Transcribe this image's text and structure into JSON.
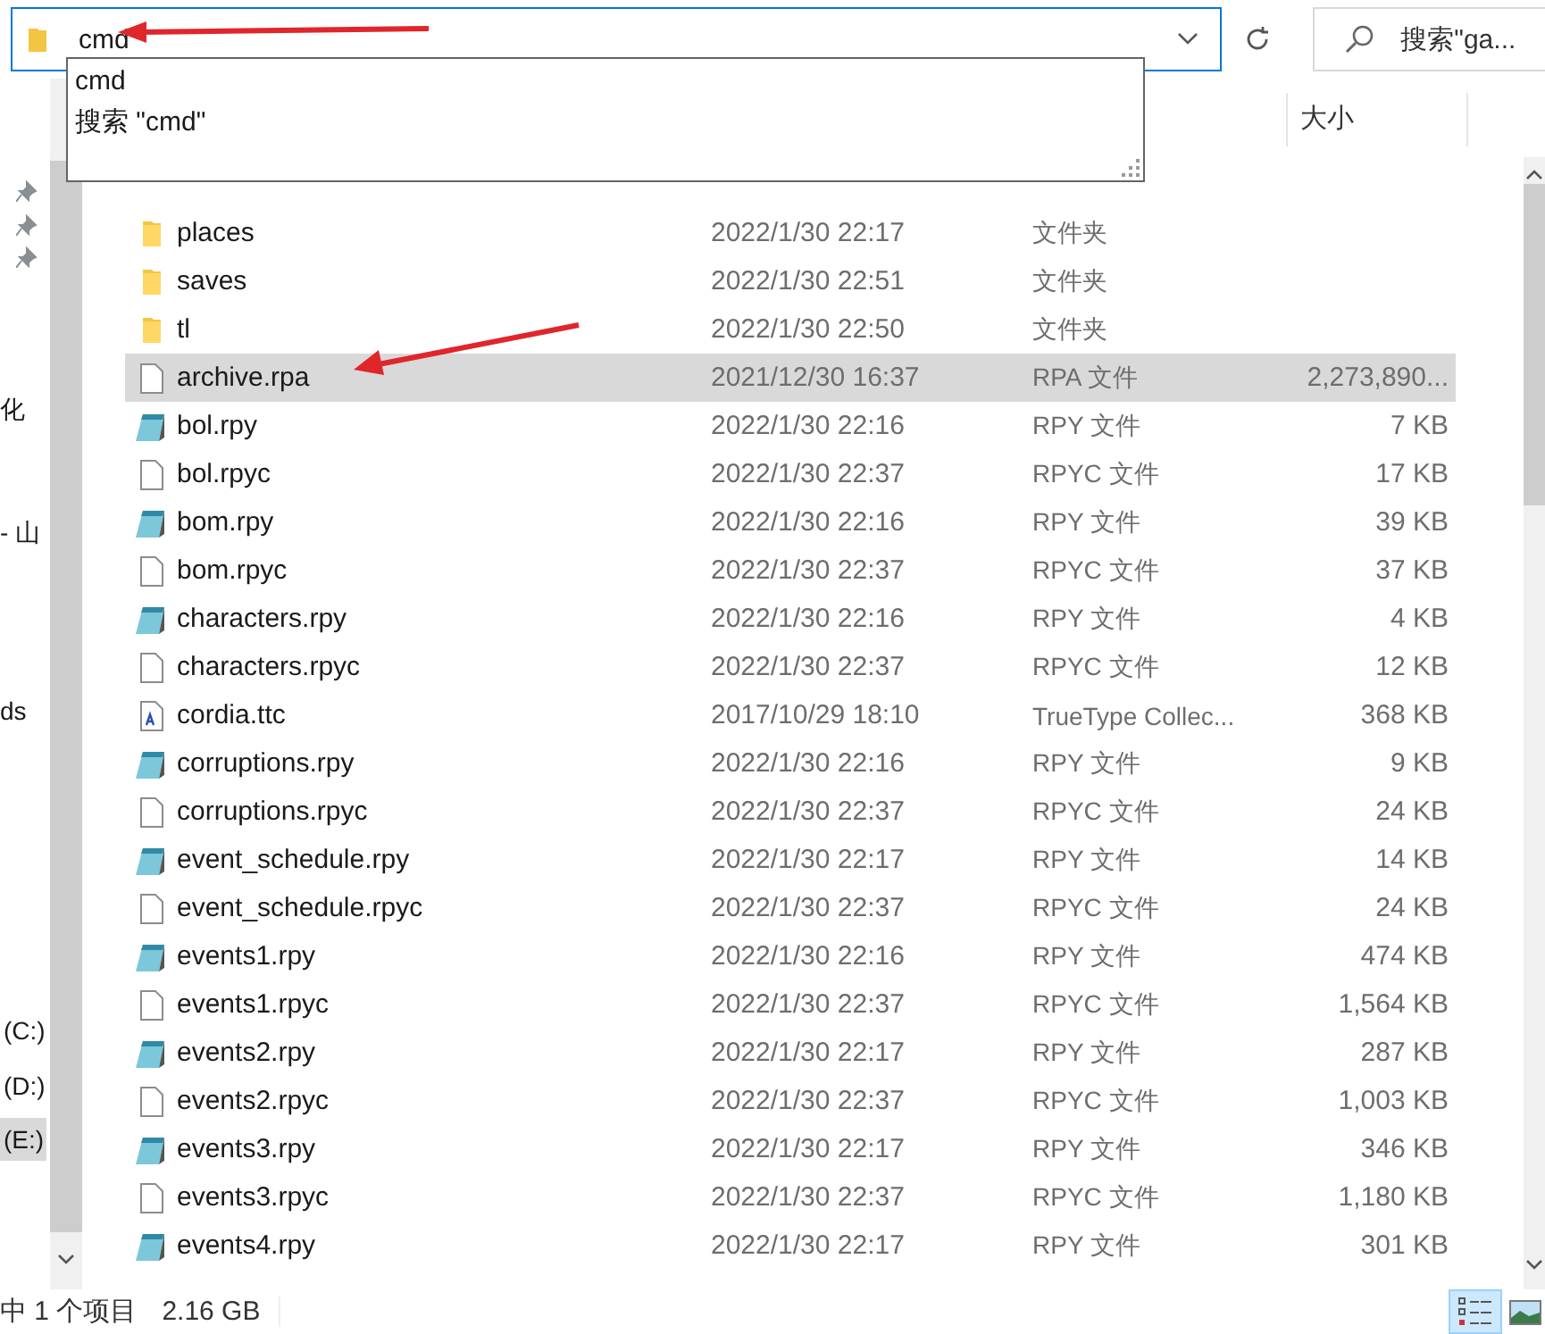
{
  "address_bar": {
    "value": "cmd"
  },
  "search": {
    "placeholder": "搜索\"ga..."
  },
  "autocomplete": [
    {
      "text": "cmd"
    },
    {
      "text": "搜索 \"cmd\""
    }
  ],
  "nav_pane": {
    "items": [
      {
        "kind": "pin"
      },
      {
        "kind": "pin"
      },
      {
        "kind": "pin"
      },
      {
        "kind": "label",
        "label": "化"
      },
      {
        "kind": "label",
        "label": "- 山"
      },
      {
        "kind": "label",
        "label": "ds"
      },
      {
        "kind": "drive",
        "label": "(C:)",
        "selected": false
      },
      {
        "kind": "drive",
        "label": "(D:)",
        "selected": false
      },
      {
        "kind": "drive",
        "label": "(E:)",
        "selected": true
      }
    ]
  },
  "columns": [
    {
      "label": "大小"
    }
  ],
  "rows": [
    {
      "kind": "folder",
      "name": "places",
      "date": "2022/1/30 22:17",
      "type": "文件夹",
      "selected": false
    },
    {
      "kind": "folder",
      "name": "saves",
      "date": "2022/1/30 22:51",
      "type": "文件夹",
      "selected": false
    },
    {
      "kind": "folder",
      "name": "tl",
      "date": "2022/1/30 22:50",
      "type": "文件夹",
      "selected": false
    },
    {
      "kind": "blank",
      "name": "archive.rpa",
      "date": "2021/12/30 16:37",
      "type": "RPA 文件",
      "size": "2,273,890...",
      "selected": true
    },
    {
      "kind": "script",
      "name": "bol.rpy",
      "date": "2022/1/30 22:16",
      "type": "RPY 文件",
      "size": "7 KB",
      "selected": false
    },
    {
      "kind": "blank",
      "name": "bol.rpyc",
      "date": "2022/1/30 22:37",
      "type": "RPYC 文件",
      "size": "17 KB",
      "selected": false
    },
    {
      "kind": "script",
      "name": "bom.rpy",
      "date": "2022/1/30 22:16",
      "type": "RPY 文件",
      "size": "39 KB",
      "selected": false
    },
    {
      "kind": "blank",
      "name": "bom.rpyc",
      "date": "2022/1/30 22:37",
      "type": "RPYC 文件",
      "size": "37 KB",
      "selected": false
    },
    {
      "kind": "script",
      "name": "characters.rpy",
      "date": "2022/1/30 22:16",
      "type": "RPY 文件",
      "size": "4 KB",
      "selected": false
    },
    {
      "kind": "blank",
      "name": "characters.rpyc",
      "date": "2022/1/30 22:37",
      "type": "RPYC 文件",
      "size": "12 KB",
      "selected": false
    },
    {
      "kind": "font",
      "name": "cordia.ttc",
      "date": "2017/10/29 18:10",
      "type": "TrueType Collec...",
      "size": "368 KB",
      "selected": false
    },
    {
      "kind": "script",
      "name": "corruptions.rpy",
      "date": "2022/1/30 22:16",
      "type": "RPY 文件",
      "size": "9 KB",
      "selected": false
    },
    {
      "kind": "blank",
      "name": "corruptions.rpyc",
      "date": "2022/1/30 22:37",
      "type": "RPYC 文件",
      "size": "24 KB",
      "selected": false
    },
    {
      "kind": "script",
      "name": "event_schedule.rpy",
      "date": "2022/1/30 22:17",
      "type": "RPY 文件",
      "size": "14 KB",
      "selected": false
    },
    {
      "kind": "blank",
      "name": "event_schedule.rpyc",
      "date": "2022/1/30 22:37",
      "type": "RPYC 文件",
      "size": "24 KB",
      "selected": false
    },
    {
      "kind": "script",
      "name": "events1.rpy",
      "date": "2022/1/30 22:16",
      "type": "RPY 文件",
      "size": "474 KB",
      "selected": false
    },
    {
      "kind": "blank",
      "name": "events1.rpyc",
      "date": "2022/1/30 22:37",
      "type": "RPYC 文件",
      "size": "1,564 KB",
      "selected": false
    },
    {
      "kind": "script",
      "name": "events2.rpy",
      "date": "2022/1/30 22:17",
      "type": "RPY 文件",
      "size": "287 KB",
      "selected": false
    },
    {
      "kind": "blank",
      "name": "events2.rpyc",
      "date": "2022/1/30 22:37",
      "type": "RPYC 文件",
      "size": "1,003 KB",
      "selected": false
    },
    {
      "kind": "script",
      "name": "events3.rpy",
      "date": "2022/1/30 22:17",
      "type": "RPY 文件",
      "size": "346 KB",
      "selected": false
    },
    {
      "kind": "blank",
      "name": "events3.rpyc",
      "date": "2022/1/30 22:37",
      "type": "RPYC 文件",
      "size": "1,180 KB",
      "selected": false
    },
    {
      "kind": "script",
      "name": "events4.rpy",
      "date": "2022/1/30 22:17",
      "type": "RPY 文件",
      "size": "301 KB",
      "selected": false
    }
  ],
  "status_bar": {
    "items": [
      "中 1 个项目",
      "2.16 GB"
    ]
  },
  "view_buttons": [
    {
      "kind": "details",
      "selected": true
    },
    {
      "kind": "large_icons",
      "selected": false
    }
  ]
}
